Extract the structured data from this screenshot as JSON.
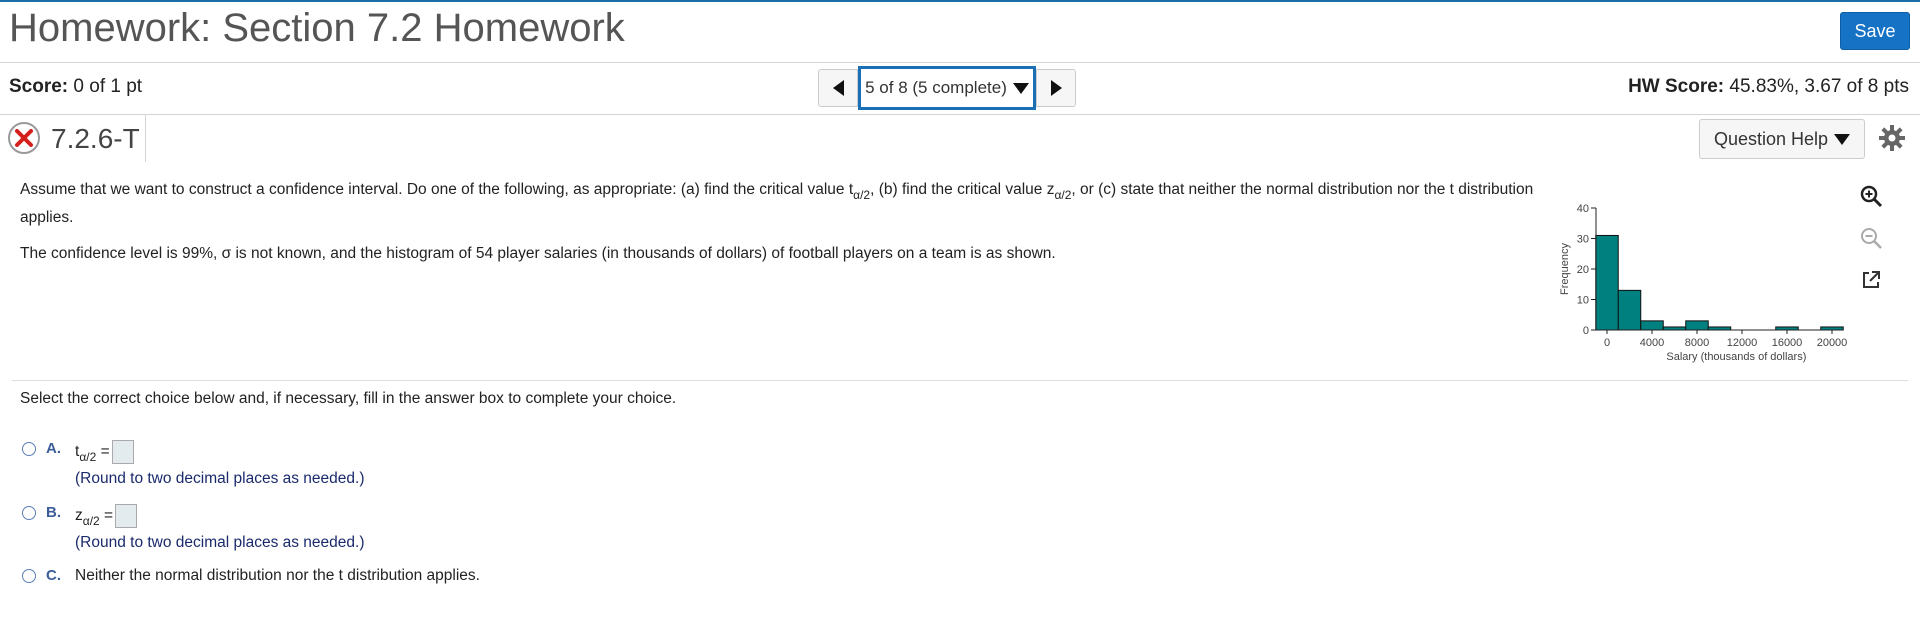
{
  "header": {
    "title": "Homework: Section 7.2 Homework",
    "save_label": "Save"
  },
  "score_row": {
    "score_label": "Score:",
    "score_value": "0 of 1 pt",
    "nav_selected": "5 of 8 (5 complete)",
    "hw_score_label": "HW Score:",
    "hw_score_value": "45.83%, 3.67 of 8 pts"
  },
  "question": {
    "id": "7.2.6-T",
    "help_label": "Question Help",
    "text_part1": "Assume that we want to construct a confidence interval. Do one of the following, as appropriate: (a) find the critical value t",
    "sub_alpha2": "α/2",
    "text_part2": ", (b) find the critical value z",
    "text_part3": ", or (c) state that neither the normal distribution nor the t distribution applies.",
    "text_para2": "The confidence level is 99%, σ is not known, and the histogram of 54 player salaries (in thousands of dollars) of football players on a team is as shown.",
    "instruction": "Select the correct choice below and, if necessary, fill in the answer box to complete your choice."
  },
  "choices": [
    {
      "letter": "A.",
      "var": "t",
      "eq": "=",
      "note": "(Round to two decimal places as needed.)"
    },
    {
      "letter": "B.",
      "var": "z",
      "eq": "=",
      "note": "(Round to two decimal places as needed.)"
    },
    {
      "letter": "C.",
      "text": "Neither the normal distribution nor the t distribution applies."
    }
  ],
  "chart_data": {
    "type": "bar",
    "title": "",
    "xlabel": "Salary (thousands of dollars)",
    "ylabel": "Frequency",
    "bin_width": 2000,
    "bin_start": -1000,
    "values": [
      31,
      13,
      3,
      1,
      3,
      1,
      0,
      0,
      1,
      0,
      1
    ],
    "xticks": [
      "0",
      "4000",
      "8000",
      "12000",
      "16000",
      "20000"
    ],
    "yticks": [
      "0",
      "10",
      "20",
      "30",
      "40"
    ],
    "ylim": [
      0,
      40
    ],
    "bar_color": "#00807f"
  },
  "icons": {
    "incorrect": "x-circle-icon",
    "settings": "gear-icon",
    "zoom_in": "zoom-in-icon",
    "zoom_out": "zoom-out-icon",
    "popout": "popout-icon"
  }
}
